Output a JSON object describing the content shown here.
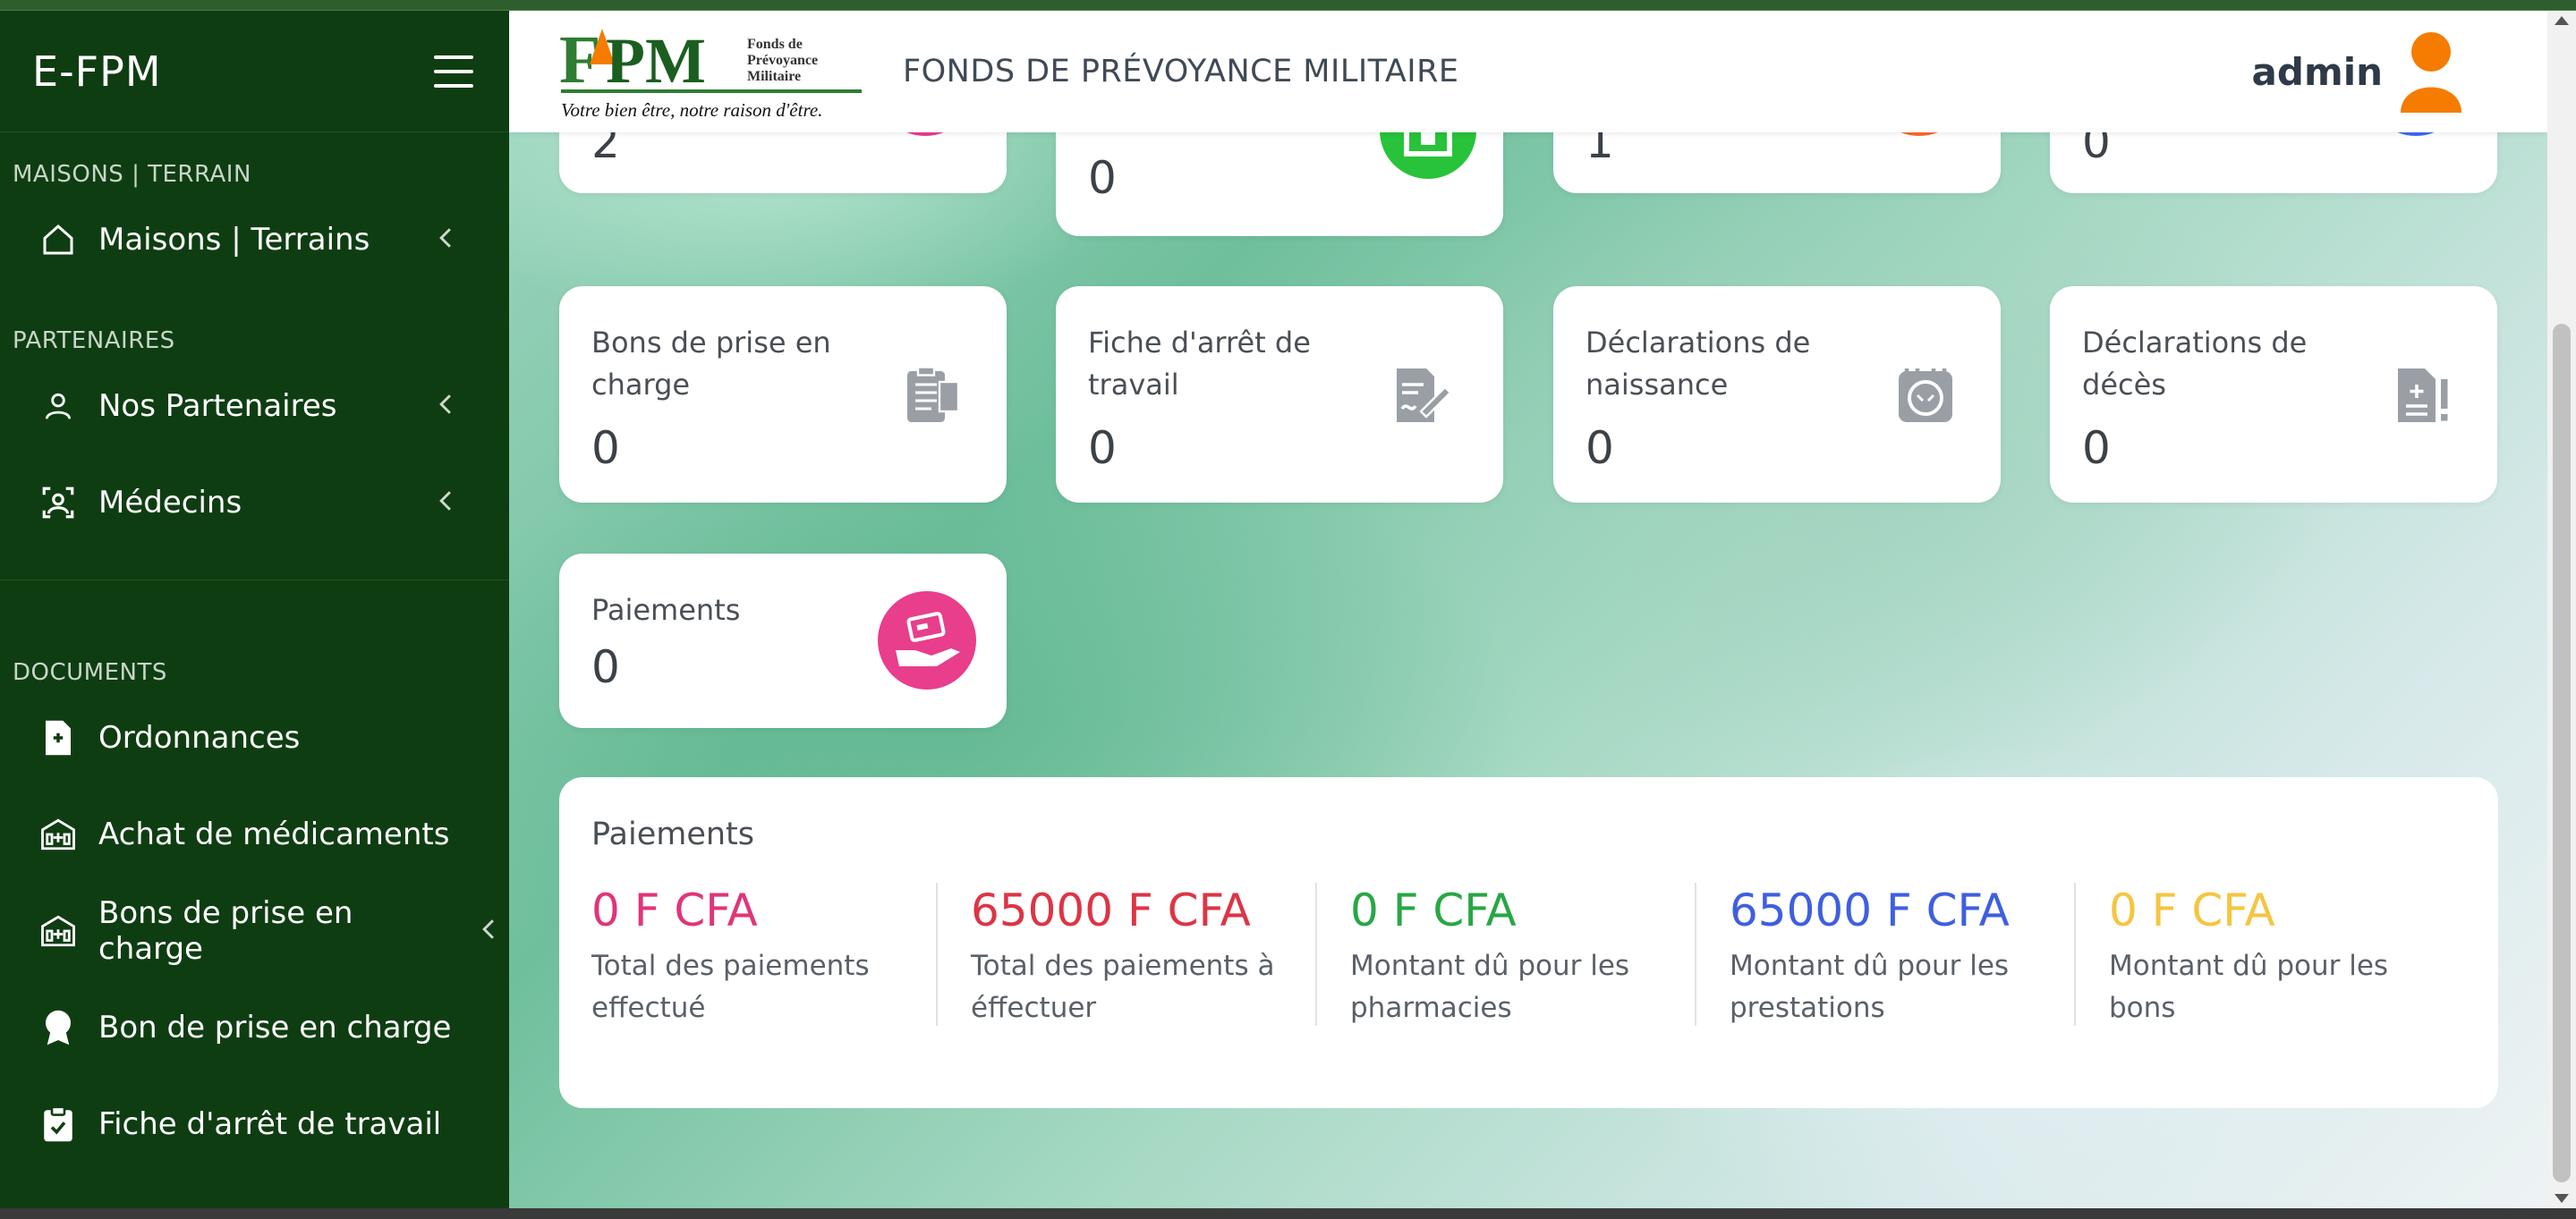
{
  "sidebar": {
    "brand": "E-FPM",
    "sections": [
      {
        "label": "MAISONS | TERRAIN",
        "items": [
          {
            "label": "Maisons | Terrains",
            "icon": "home-icon",
            "has_chevron": true
          }
        ]
      },
      {
        "label": "PARTENAIRES",
        "items": [
          {
            "label": "Nos Partenaires",
            "icon": "user-icon",
            "has_chevron": true
          },
          {
            "label": "Médecins",
            "icon": "doctor-icon",
            "has_chevron": true
          }
        ]
      },
      {
        "label": "DOCUMENTS",
        "items": [
          {
            "label": "Ordonnances",
            "icon": "prescription-icon"
          },
          {
            "label": "Achat de médicaments",
            "icon": "pharmacy-icon"
          },
          {
            "label": "Bons de prise en charge",
            "icon": "hospital-icon",
            "has_chevron": true
          },
          {
            "label": "Bon de prise en charge",
            "icon": "award-icon"
          },
          {
            "label": "Fiche d'arrêt de travail",
            "icon": "clipboard-icon"
          }
        ]
      }
    ]
  },
  "topbar": {
    "logo_text": "FPM",
    "logo_sub": "Fonds de Prévoyance Militaire",
    "logo_slogan": "Votre bien être, notre raison d'être.",
    "org_name": "FONDS DE PRÉVOYANCE MILITAIRE",
    "user_name": "admin"
  },
  "top_cards": [
    {
      "value": "2",
      "icon_color": "#e83e8c"
    },
    {
      "value": "0",
      "icon_color": "#28c33a"
    },
    {
      "value": "1",
      "icon_color": "#fd6b2e"
    },
    {
      "value": "0",
      "icon_color": "#3f6cf0"
    }
  ],
  "cards": [
    {
      "label": "Bons de prise en charge",
      "value": "0",
      "icon": "clipboard-list-icon"
    },
    {
      "label": "Fiche d'arrêt de travail",
      "value": "0",
      "icon": "file-signature-icon"
    },
    {
      "label": "Déclarations de naissance",
      "value": "0",
      "icon": "baby-icon"
    },
    {
      "label": "Déclarations de décès",
      "value": "0",
      "icon": "file-medical-icon"
    },
    {
      "label": "Paiements",
      "value": "0",
      "icon": "hand-payment-icon",
      "icon_color": "#e83e8c"
    }
  ],
  "payments": {
    "title": "Paiements",
    "items": [
      {
        "amount": "0 F CFA",
        "desc": "Total des paiements effectué",
        "color": "#e0357a"
      },
      {
        "amount": "65000 F CFA",
        "desc": "Total des paiements à éffectuer",
        "color": "#dc3545"
      },
      {
        "amount": "0 F CFA",
        "desc": "Montant dû pour les pharmacies",
        "color": "#28a745"
      },
      {
        "amount": "65000 F CFA",
        "desc": "Montant dû pour les prestations",
        "color": "#3f5fe0"
      },
      {
        "amount": "0 F CFA",
        "desc": "Montant dû pour les bons",
        "color": "#f5c542"
      }
    ]
  }
}
